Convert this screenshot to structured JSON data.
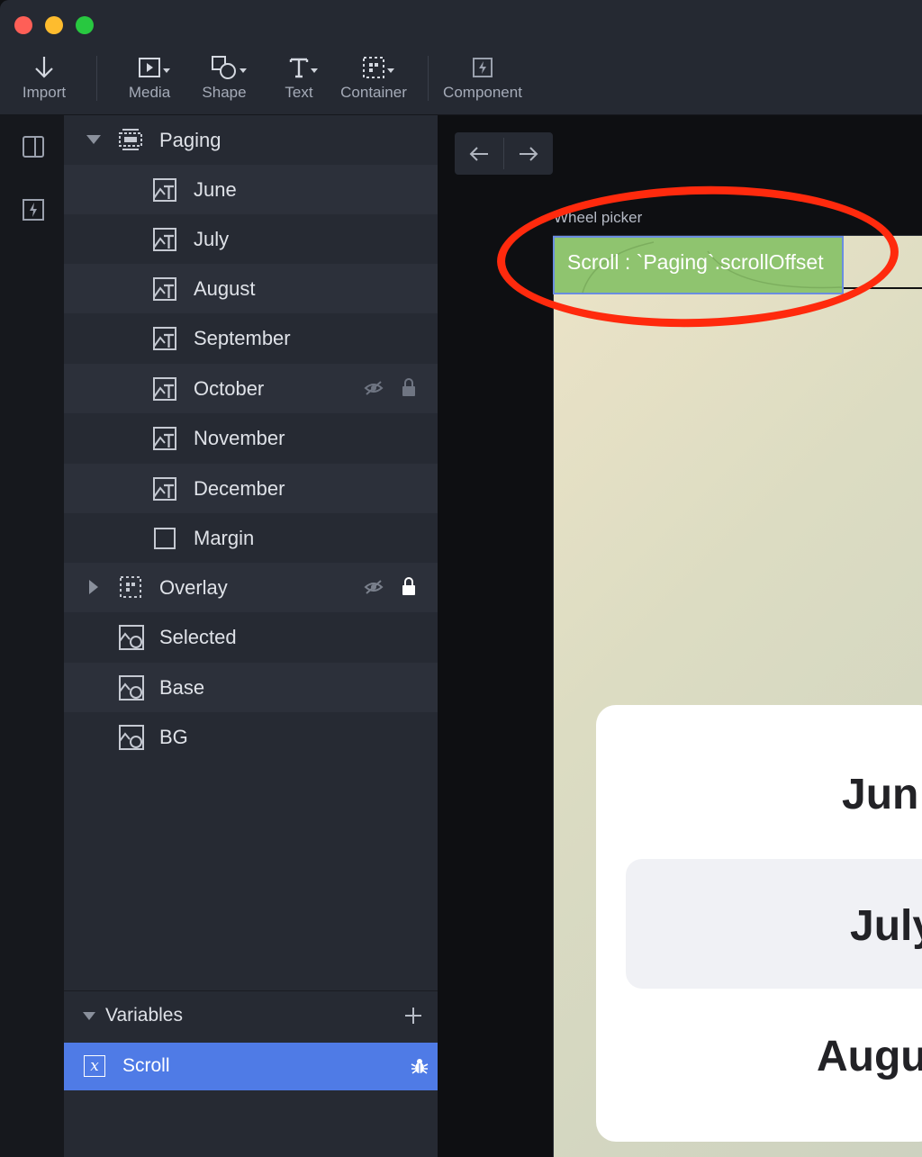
{
  "toolbar": {
    "import_label": "Import",
    "media_label": "Media",
    "shape_label": "Shape",
    "text_label": "Text",
    "container_label": "Container",
    "component_label": "Component"
  },
  "rail": {
    "icons": [
      "panel-toggle-icon",
      "component-bolt-icon"
    ]
  },
  "layers": {
    "group": {
      "label": "Paging",
      "icon": "container-icon",
      "expanded": true
    },
    "children": [
      {
        "label": "June",
        "icon": "image-text-icon"
      },
      {
        "label": "July",
        "icon": "image-text-icon"
      },
      {
        "label": "August",
        "icon": "image-text-icon"
      },
      {
        "label": "September",
        "icon": "image-text-icon"
      },
      {
        "label": "October",
        "icon": "image-text-icon",
        "hidden": true,
        "locked": true
      },
      {
        "label": "November",
        "icon": "image-text-icon"
      },
      {
        "label": "December",
        "icon": "image-text-icon"
      },
      {
        "label": "Margin",
        "icon": "rectangle-icon"
      }
    ],
    "overlay": {
      "label": "Overlay",
      "icon": "container-icon",
      "expanded": false,
      "hidden": true,
      "locked": true
    },
    "others": [
      {
        "label": "Selected",
        "icon": "image-shape-icon"
      },
      {
        "label": "Base",
        "icon": "image-shape-icon"
      },
      {
        "label": "BG",
        "icon": "image-shape-icon"
      }
    ]
  },
  "variables": {
    "header_label": "Variables",
    "items": [
      {
        "label": "Scroll",
        "selected": true
      }
    ]
  },
  "canvas": {
    "frame_label": "Wheel picker",
    "variable_badge": "Scroll : `Paging`.scrollOffset",
    "months_visible": [
      "Jun",
      "July",
      "Augu"
    ]
  },
  "colors": {
    "accent": "#4f7be6",
    "badge_green": "#8fc46f",
    "annotation_red": "#ff2a0d"
  }
}
